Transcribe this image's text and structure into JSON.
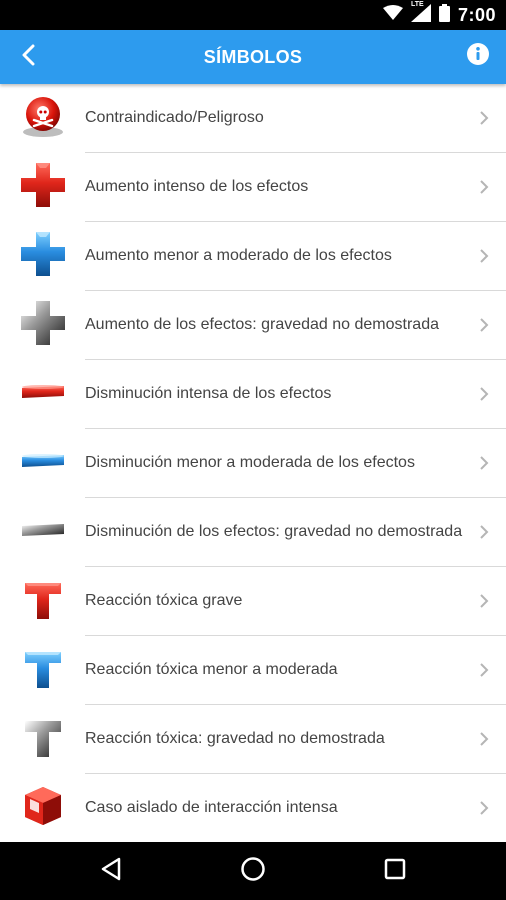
{
  "status_bar": {
    "time": "7:00",
    "network_label": "LTE",
    "icons": [
      "wifi-icon",
      "cell-signal-icon",
      "battery-icon"
    ]
  },
  "app_bar": {
    "title": "SÍMBOLOS",
    "back_icon": "chevron-left-icon",
    "info_icon": "info-icon",
    "color": "#2d9bee"
  },
  "list": {
    "items": [
      {
        "label": "Contraindicado/Peligroso",
        "icon": "skull-warning-icon"
      },
      {
        "label": "Aumento intenso de los efectos",
        "icon": "plus-red-icon"
      },
      {
        "label": "Aumento menor a moderado de los efectos",
        "icon": "plus-blue-icon"
      },
      {
        "label": "Aumento de los efectos: gravedad no demostrada",
        "icon": "plus-gray-icon"
      },
      {
        "label": "Disminución intensa de los efectos",
        "icon": "minus-red-icon"
      },
      {
        "label": "Disminución menor a moderada de los efectos",
        "icon": "minus-blue-icon"
      },
      {
        "label": "Disminución de los efectos: gravedad no demostrada",
        "icon": "minus-gray-icon"
      },
      {
        "label": "Reacción tóxica grave",
        "icon": "t-red-icon"
      },
      {
        "label": "Reacción tóxica menor a moderada",
        "icon": "t-blue-icon"
      },
      {
        "label": "Reacción tóxica: gravedad no demostrada",
        "icon": "t-gray-icon"
      },
      {
        "label": "Caso aislado de interacción intensa",
        "icon": "cube-red-icon"
      }
    ]
  },
  "nav_bar": {
    "icons": [
      "back-triangle-icon",
      "home-circle-icon",
      "recents-square-icon"
    ]
  }
}
